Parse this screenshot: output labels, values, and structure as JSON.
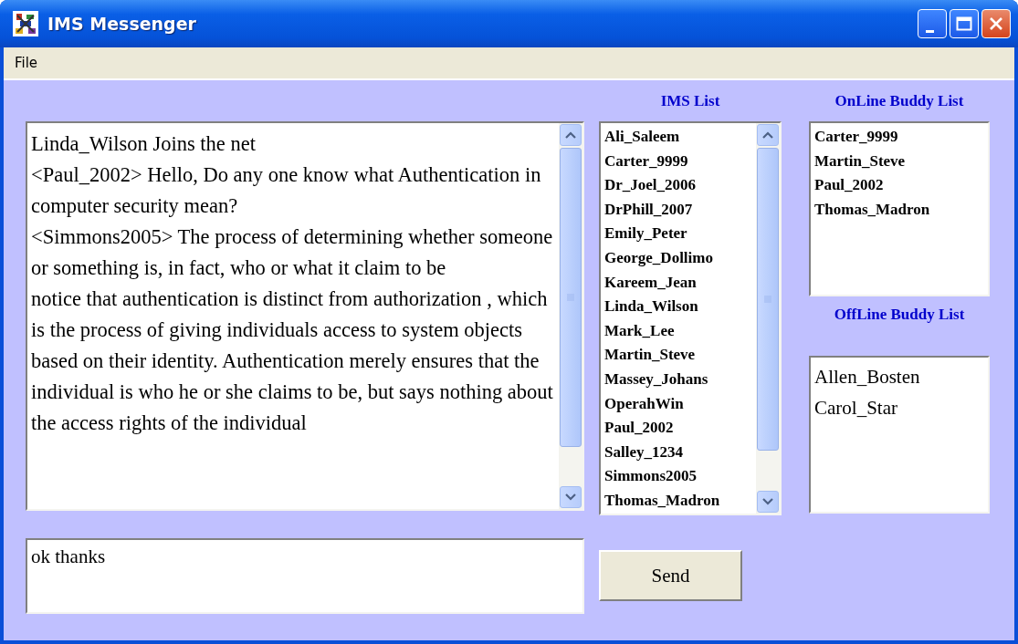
{
  "window": {
    "title": "IMS Messenger"
  },
  "menu": [
    "File"
  ],
  "chat": {
    "messages": [
      "Linda_Wilson Joins the net",
      "<Paul_2002> Hello, Do any one know what Authentication in computer security mean?",
      "<Simmons2005> The process of determining whether someone or something is, in fact, who or what it claim to be",
      "notice that authentication is distinct from authorization , which is the process of giving individuals access to system objects based on their identity. Authentication merely ensures that the individual is who he or she claims to be, but says nothing about the access rights of the individual"
    ]
  },
  "message_input": {
    "value": "ok thanks"
  },
  "send_button": "Send",
  "ims_list": {
    "title": "IMS List",
    "items": [
      "Ali_Saleem",
      "Carter_9999",
      "Dr_Joel_2006",
      "DrPhill_2007",
      "Emily_Peter",
      "George_Dollimo",
      "Kareem_Jean",
      "Linda_Wilson",
      "Mark_Lee",
      "Martin_Steve",
      "Massey_Johans",
      "OperahWin",
      "Paul_2002",
      "Salley_1234",
      "Simmons2005",
      "Thomas_Madron"
    ]
  },
  "online_buddies": {
    "title": "OnLine Buddy List",
    "items": [
      "Carter_9999",
      "Martin_Steve",
      "Paul_2002",
      "Thomas_Madron"
    ]
  },
  "offline_buddies": {
    "title": "OffLine Buddy List",
    "items": [
      "Allen_Bosten",
      "Carol_Star"
    ]
  }
}
